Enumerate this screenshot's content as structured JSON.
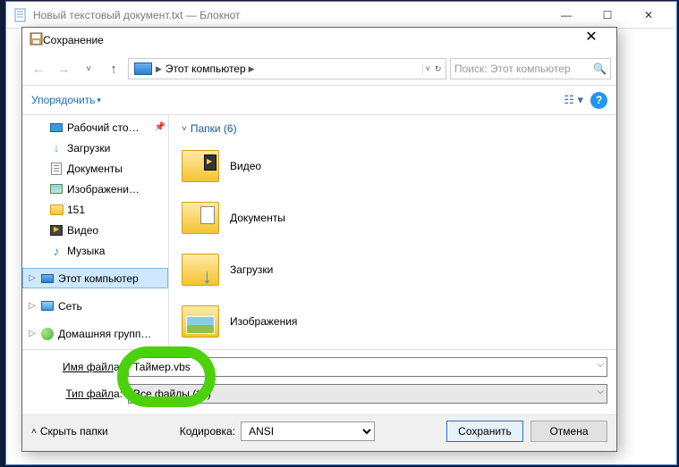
{
  "notepad": {
    "title": "Новый текстовый документ.txt — Блокнот"
  },
  "dialog": {
    "title": "Сохранение",
    "path_segment": "Этот компьютер",
    "search_placeholder": "Поиск: Этот компьютер",
    "organize": "Упорядочить",
    "folders_heading": "Папки (6)",
    "hide_folders": "Скрыть папки",
    "encoding_label": "Кодировка:",
    "encoding_value": "ANSI",
    "save": "Сохранить",
    "cancel": "Отмена",
    "filename_label_pre": "Имя файл",
    "filename_label_u": "а",
    "filename_label_post": ":",
    "filetype_label_pre": "Тип файл",
    "filetype_label_u": "а",
    "filetype_label_post": ":",
    "filename_value": "Таймер.vbs",
    "filetype_value": "Все файлы  (*.*)"
  },
  "sidebar": [
    {
      "label": "Рабочий сто…",
      "icon": "desktop"
    },
    {
      "label": "Загрузки",
      "icon": "dl"
    },
    {
      "label": "Документы",
      "icon": "doc"
    },
    {
      "label": "Изображени…",
      "icon": "img"
    },
    {
      "label": "151",
      "icon": "folder"
    },
    {
      "label": "Видео",
      "icon": "video"
    },
    {
      "label": "Музыка",
      "icon": "music"
    },
    {
      "label": "Этот компьютер",
      "icon": "pc",
      "selected": true,
      "expandable": true
    },
    {
      "label": "Сеть",
      "icon": "net",
      "expandable": true
    },
    {
      "label": "Домашняя групп…",
      "icon": "home",
      "expandable": true
    }
  ],
  "folders": [
    {
      "label": "Видео"
    },
    {
      "label": "Документы"
    },
    {
      "label": "Загрузки"
    },
    {
      "label": "Изображения"
    }
  ]
}
